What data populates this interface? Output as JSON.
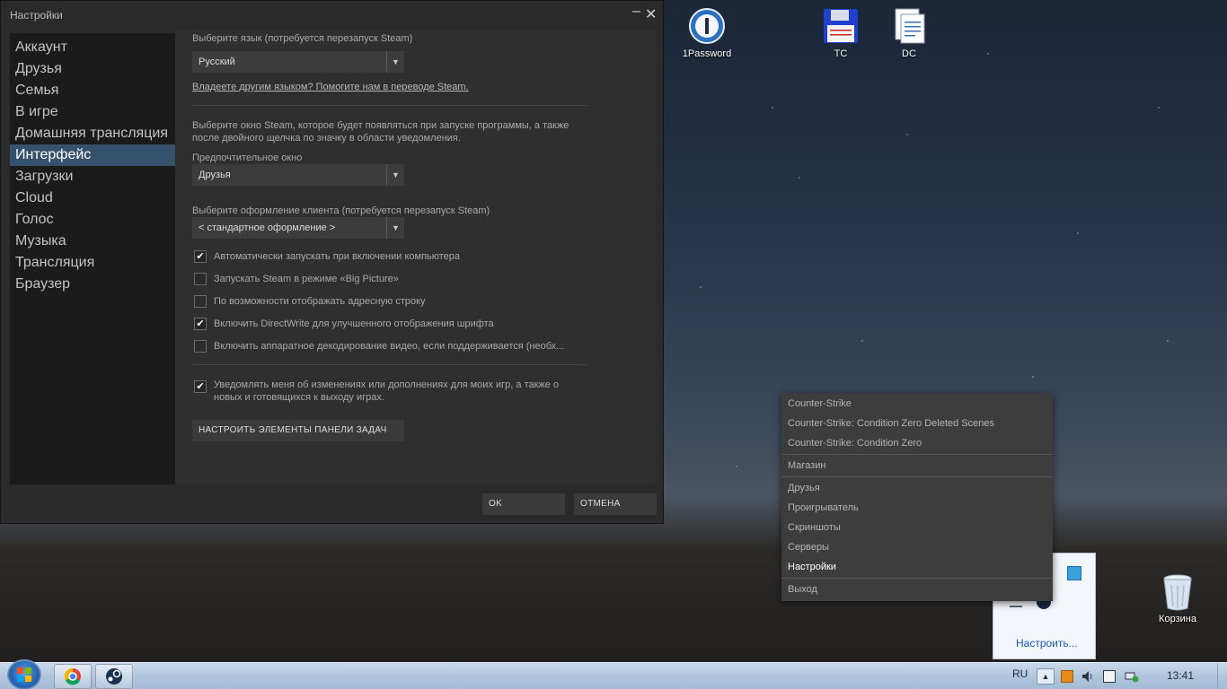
{
  "window": {
    "title": "Настройки",
    "minimize_glyph": "–",
    "close_glyph": "✕"
  },
  "sidebar": {
    "items": [
      {
        "label": "Аккаунт"
      },
      {
        "label": "Друзья"
      },
      {
        "label": "Семья"
      },
      {
        "label": "В игре"
      },
      {
        "label": "Домашняя трансляция"
      },
      {
        "label": "Интерфейс",
        "active": true
      },
      {
        "label": "Загрузки"
      },
      {
        "label": "Cloud"
      },
      {
        "label": "Голос"
      },
      {
        "label": "Музыка"
      },
      {
        "label": "Трансляция"
      },
      {
        "label": "Браузер"
      }
    ]
  },
  "interface": {
    "language_label": "Выберите язык (потребуется перезапуск Steam)",
    "language_value": "Русский",
    "translate_link": "Владеете другим языком? Помогите нам в переводе Steam.",
    "window_desc": "Выберите окно Steam, которое будет появляться при запуске программы, а также после двойного щелчка по значку в области уведомления.",
    "preferred_window_label": "Предпочтительное окно",
    "preferred_window_value": "Друзья",
    "skin_label": "Выберите оформление клиента (потребуется перезапуск Steam)",
    "skin_value": "< стандартное оформление >",
    "checkboxes": [
      {
        "label": "Автоматически запускать при включении компьютера",
        "checked": true
      },
      {
        "label": "Запускать Steam в режиме «Big Picture»",
        "checked": false
      },
      {
        "label": "По возможности отображать адресную строку",
        "checked": false
      },
      {
        "label": "Включить DirectWrite для улучшенного отображения шрифта",
        "checked": true
      },
      {
        "label": "Включить аппаратное декодирование видео, если поддерживается (необх...",
        "checked": false
      }
    ],
    "notify": {
      "label": "Уведомлять меня об изменениях или дополнениях для моих игр, а также о новых и готовящихся к выходу играх.",
      "checked": true
    },
    "taskbar_button": "НАСТРОИТЬ ЭЛЕМЕНТЫ ПАНЕЛИ ЗАДАЧ",
    "check_glyph": "✔"
  },
  "footer": {
    "ok": "OK",
    "cancel": "ОТМЕНА"
  },
  "desktop": {
    "icons": [
      {
        "label": "1Password",
        "icon": "1password-icon"
      },
      {
        "label": "TC",
        "icon": "floppy-disk-icon"
      },
      {
        "label": "DC",
        "icon": "document-icon"
      },
      {
        "label": "Корзина",
        "icon": "recycle-bin-icon"
      }
    ]
  },
  "context_menu": {
    "items": [
      {
        "label": "Counter-Strike"
      },
      {
        "label": "Counter-Strike: Condition Zero Deleted Scenes"
      },
      {
        "label": "Counter-Strike: Condition Zero"
      },
      {
        "label": "Магазин"
      },
      {
        "label": "Друзья"
      },
      {
        "label": "Проигрыватель"
      },
      {
        "label": "Скриншоты"
      },
      {
        "label": "Серверы"
      },
      {
        "label": "Настройки",
        "highlighted": true
      },
      {
        "label": "Выход"
      }
    ]
  },
  "tray_popup": {
    "customize": "Настроить..."
  },
  "taskbar": {
    "language": "RU",
    "time": "13:41",
    "pinned": [
      {
        "icon": "chrome-icon"
      },
      {
        "icon": "steam-icon"
      }
    ]
  },
  "colors": {
    "active_nav": "#36516c",
    "panel_bg": "#2f2f2f",
    "sidebar_bg": "#1b1b1b"
  }
}
